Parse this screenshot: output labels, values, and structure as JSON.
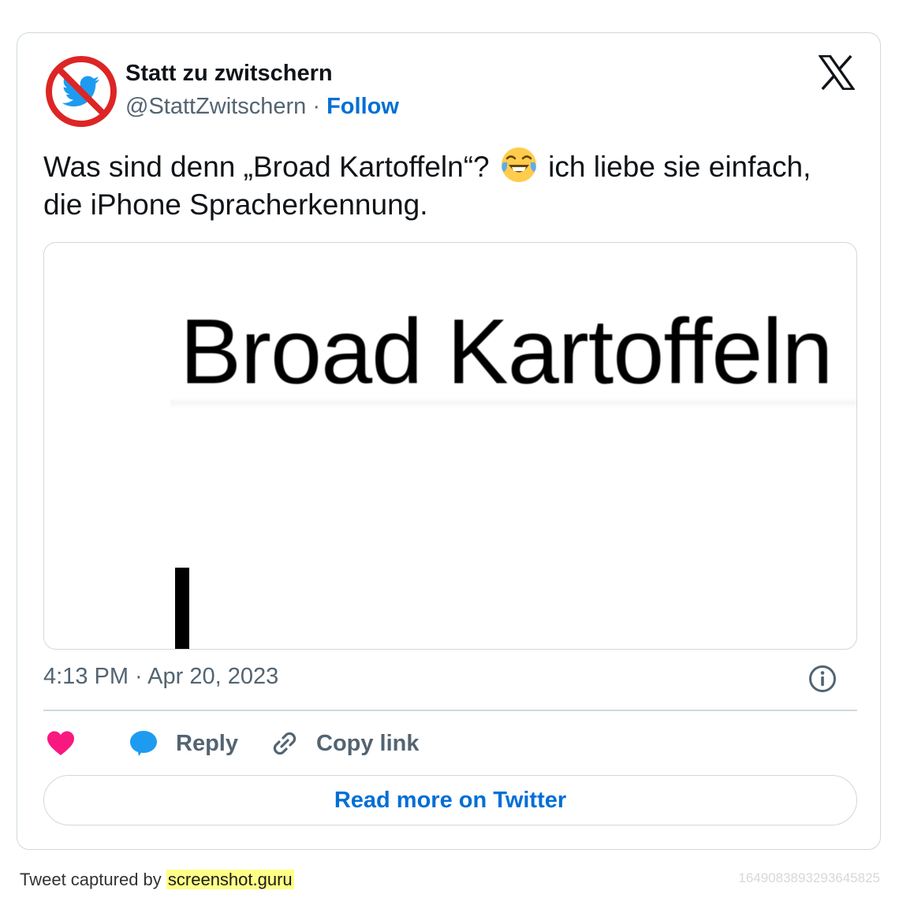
{
  "author": {
    "name": "Statt zu zwitschern",
    "handle": "@StattZwitschern",
    "separator": "·",
    "follow_label": "Follow",
    "avatar_icon": "no-twitter-bird-icon"
  },
  "brand_icon": "x-logo-icon",
  "tweet": {
    "text_before_emoji": "Was sind denn „Broad Kartoffeln“? ",
    "emoji_icon": "face-with-tears-of-joy-icon",
    "text_after_emoji": " ich liebe sie einfach, die iPhone Spracherkennung."
  },
  "media": {
    "caption_text": "Broad Kartoffeln"
  },
  "timestamp": "4:13 PM · Apr 20, 2023",
  "actions": {
    "reply_label": "Reply",
    "copy_label": "Copy link"
  },
  "read_more_label": "Read more on Twitter",
  "footer": {
    "captured_by": "Tweet captured by ",
    "site": "screenshot.guru",
    "tweet_id": "1649083893293645825"
  },
  "colors": {
    "link": "#006fd6",
    "secondary_text": "#536471",
    "like": "#f91880",
    "reply": "#1d9bf0",
    "border": "#cfd9de",
    "highlight": "#ffff88"
  }
}
